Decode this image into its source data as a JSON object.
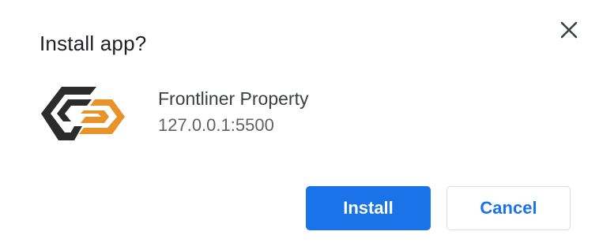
{
  "dialog": {
    "title": "Install app?",
    "close_icon": "close-icon"
  },
  "app": {
    "name": "Frontliner Property",
    "origin": "127.0.0.1:5500",
    "icon": "frontliner-logo-icon",
    "colors": {
      "dark": "#2b2b2b",
      "accent": "#e8922a"
    }
  },
  "actions": {
    "install_label": "Install",
    "cancel_label": "Cancel",
    "primary_color": "#1a73e8"
  }
}
